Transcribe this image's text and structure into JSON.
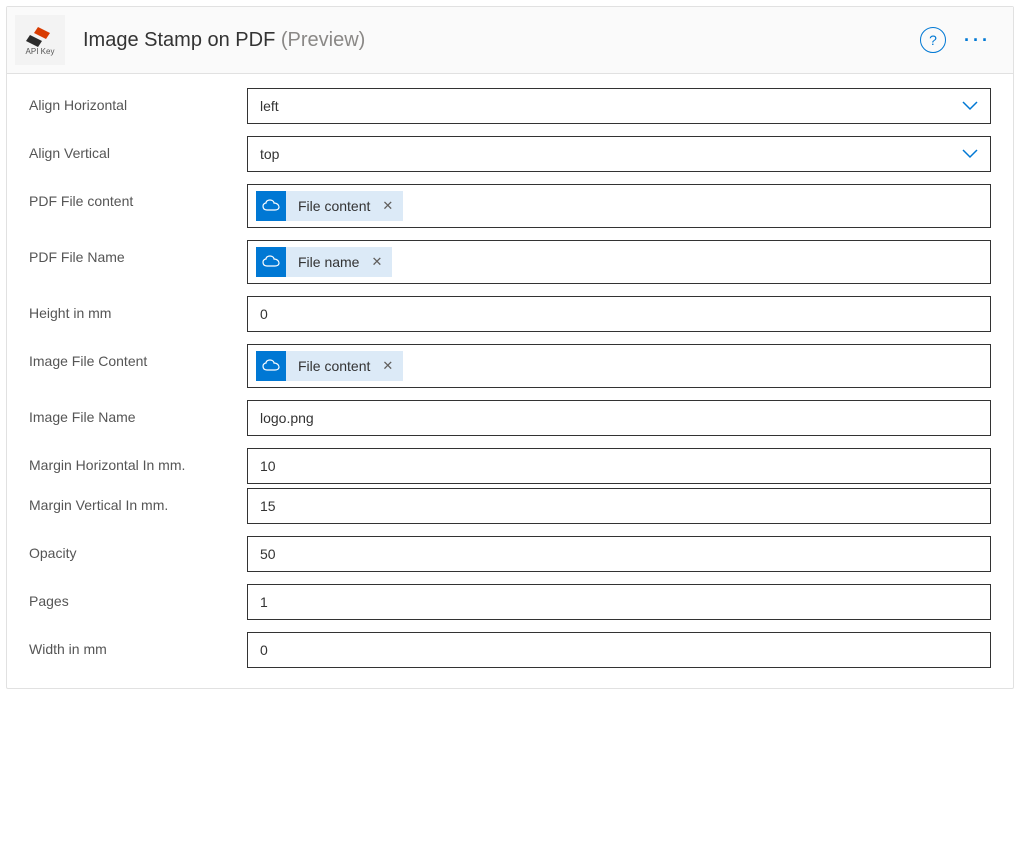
{
  "header": {
    "api_key_label": "API Key",
    "title": "Image Stamp on PDF",
    "preview": "(Preview)"
  },
  "fields": {
    "align_horizontal": {
      "label": "Align Horizontal",
      "value": "left"
    },
    "align_vertical": {
      "label": "Align Vertical",
      "value": "top"
    },
    "pdf_file_content": {
      "label": "PDF File content",
      "token": "File content"
    },
    "pdf_file_name": {
      "label": "PDF File Name",
      "token": "File name"
    },
    "height_mm": {
      "label": "Height in mm",
      "value": "0"
    },
    "image_file_content": {
      "label": "Image File Content",
      "token": "File content"
    },
    "image_file_name": {
      "label": "Image File Name",
      "value": "logo.png"
    },
    "margin_h": {
      "label": "Margin Horizontal In mm.",
      "value": "10"
    },
    "margin_v": {
      "label": "Margin Vertical In mm.",
      "value": "15"
    },
    "opacity": {
      "label": "Opacity",
      "value": "50"
    },
    "pages": {
      "label": "Pages",
      "value": "1"
    },
    "width_mm": {
      "label": "Width in mm",
      "value": "0"
    }
  }
}
